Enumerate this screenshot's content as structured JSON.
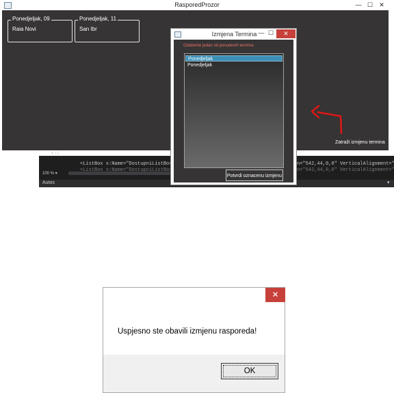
{
  "main_window": {
    "title": "RasporedProzor",
    "minimize": "—",
    "maximize": "☐",
    "close": "✕",
    "days": [
      {
        "legend": "Ponedjeljak, 09",
        "item": "Raia Novi"
      },
      {
        "legend": "Ponedjeljak, 11",
        "item": "San Ibr"
      }
    ],
    "cancel_change_button": "Zatraži izmjenu termina"
  },
  "editor": {
    "line1": "<ListBox x:Name=\"DostupniListBox\"",
    "line2": "<ListBox x:Name=\"DostupniListBox\"",
    "right1": "n=\"542,44,0,0\" VerticalAlignment=\"To",
    "right2": "n=\"542,44,0,0\" VerticalAlignment=\"To",
    "zoom": "100 % ▾",
    "misc": "▾ 12",
    "output_label": "Autos",
    "output_caret": "▾"
  },
  "term_dialog": {
    "title": "Izmjena Termina",
    "minimize": "—",
    "maximize": "☐",
    "close": "✕",
    "instruction": "Odaberite jedan od ponudenih termina:",
    "items": [
      "Ponedjeljak",
      "Ponedjeljak"
    ],
    "confirm_button": "Potvrdi oznacenu izmjenu"
  },
  "message_box": {
    "close": "✕",
    "text": "Uspjesno ste obavili izmjenu rasporeda!",
    "ok_button": "OK"
  },
  "colors": {
    "window_background": "#363434",
    "close_red": "#c7403a",
    "selected_item": "#3a8fb7",
    "annotation_arrow": "#e01616",
    "instruction_text": "#e8706a"
  }
}
